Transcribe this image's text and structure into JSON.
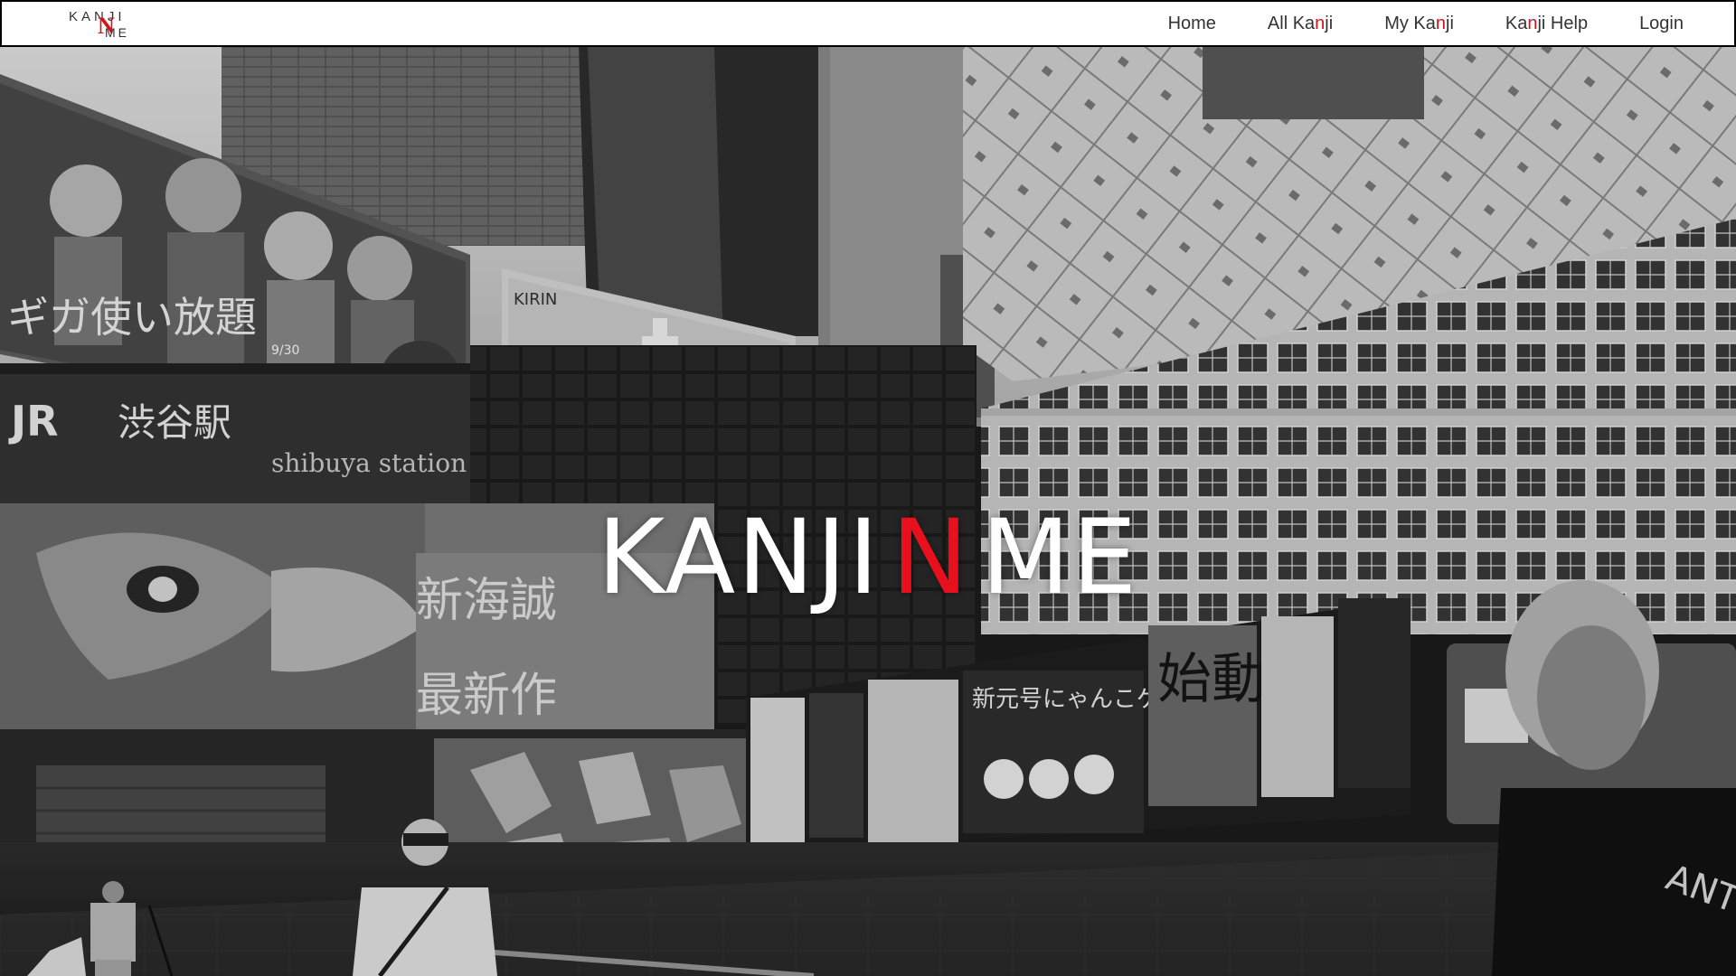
{
  "logo": {
    "top_text": "KANJI",
    "middle_letter": "N",
    "bottom_text": "ME"
  },
  "nav": {
    "items": [
      {
        "label": "Home",
        "parts": [
          "Home",
          "",
          ""
        ]
      },
      {
        "label": "All Kanji",
        "parts": [
          "All Ka",
          "n",
          "ji"
        ]
      },
      {
        "label": "My Kanji",
        "parts": [
          "My Ka",
          "n",
          "ji"
        ]
      },
      {
        "label": "Kanji Help",
        "parts": [
          "Ka",
          "n",
          "ji Help"
        ]
      },
      {
        "label": "Login",
        "parts": [
          "Login",
          "",
          ""
        ]
      }
    ]
  },
  "hero": {
    "title_left": "KANJI",
    "title_middle": "N",
    "title_right": "ME"
  },
  "colors": {
    "accent": "#d6121b",
    "navbar_bg": "#ffffff",
    "nav_text": "#333333",
    "title_text": "#ffffff"
  }
}
